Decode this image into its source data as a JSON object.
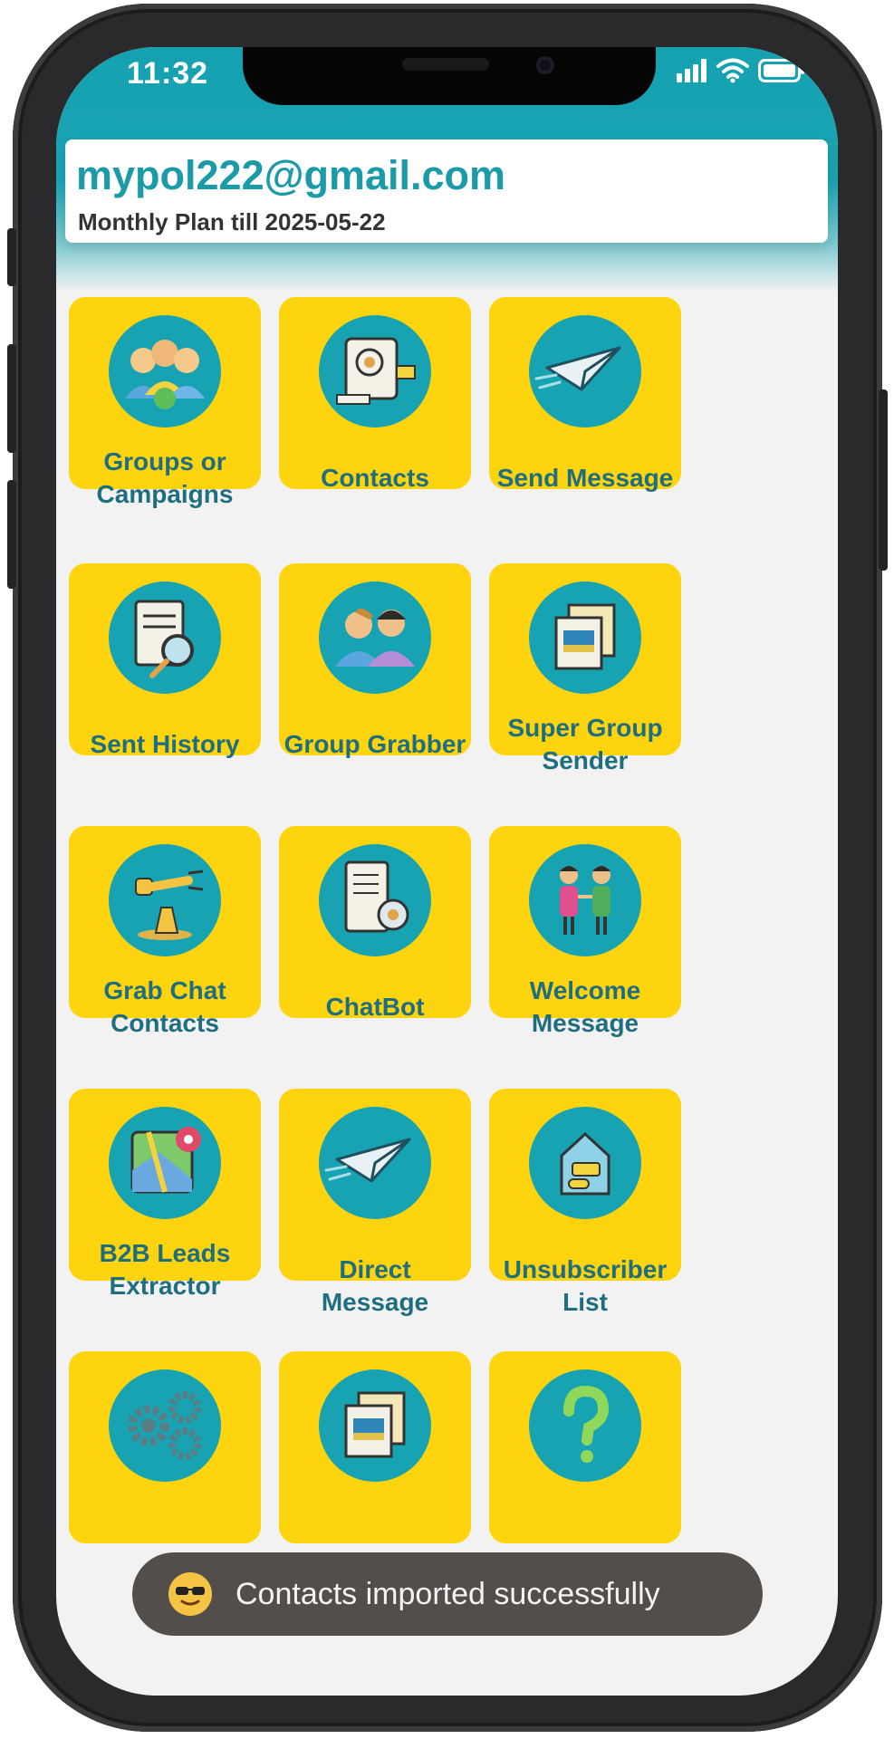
{
  "status_bar": {
    "time": "11:32"
  },
  "account": {
    "email": "mypol222@gmail.com",
    "plan": "Monthly Plan till 2025-05-22"
  },
  "tiles": [
    {
      "label": "Groups or Campaigns",
      "icon": "people-group-icon"
    },
    {
      "label": "Contacts",
      "icon": "contact-card-icon"
    },
    {
      "label": "Send Message",
      "icon": "paper-plane-icon"
    },
    {
      "label": "Sent History",
      "icon": "document-search-icon"
    },
    {
      "label": "Group Grabber",
      "icon": "two-people-icon"
    },
    {
      "label": "Super Group Sender",
      "icon": "stacked-documents-icon"
    },
    {
      "label": "Grab Chat Contacts",
      "icon": "robot-arm-icon"
    },
    {
      "label": "ChatBot",
      "icon": "chatbot-document-icon"
    },
    {
      "label": "Welcome Message",
      "icon": "greeting-people-icon"
    },
    {
      "label": "B2B Leads Extractor",
      "icon": "map-pin-icon"
    },
    {
      "label": "Direct Message",
      "icon": "paper-plane-icon"
    },
    {
      "label": "Unsubscriber List",
      "icon": "house-box-icon"
    },
    {
      "label": "",
      "icon": "gears-icon"
    },
    {
      "label": "",
      "icon": "stacked-documents-icon"
    },
    {
      "label": "",
      "icon": "question-mark-icon"
    }
  ],
  "toast": {
    "emoji": "sunglasses-face-icon",
    "text": "Contacts imported successfully"
  },
  "colors": {
    "teal": "#17a3b2",
    "tile_yellow": "#fdd40e",
    "label_teal": "#1f6e80",
    "email_teal": "#1b9aa7"
  }
}
